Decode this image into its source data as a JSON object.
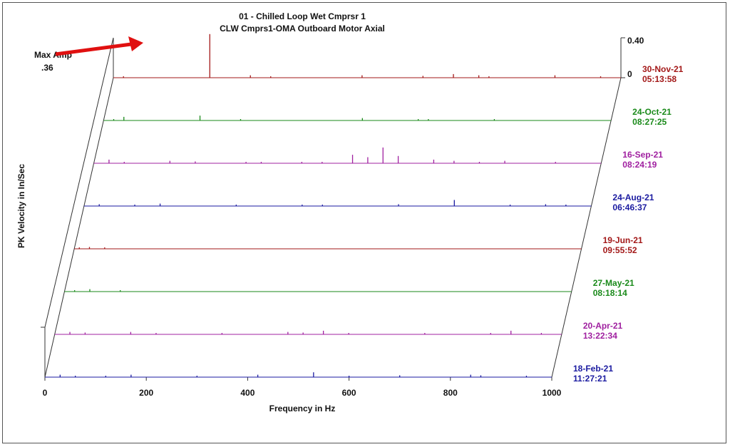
{
  "chart_data": {
    "type": "line",
    "subtype": "waterfall-spectrum",
    "title": "01   - Chilled Loop Wet Cmprsr 1",
    "subtitle": "CLW Cmprs1-OMA   Outboard Motor Axial",
    "xlabel": "Frequency in Hz",
    "ylabel": "PK Velocity in In/Sec",
    "xlim": [
      0,
      1000
    ],
    "x_ticks": [
      "0",
      "200",
      "400",
      "600",
      "800",
      "1000"
    ],
    "amp_scale": [
      0,
      0.4
    ],
    "amp_tick_labels": [
      "0.40",
      "0"
    ],
    "annotation": {
      "label": "Max Amp",
      "value": ".36"
    },
    "series": [
      {
        "date": "30-Nov-21",
        "time": "05:13:58",
        "color": "#a31818",
        "peaks": [
          [
            20,
            0.01
          ],
          [
            190,
            0.36
          ],
          [
            270,
            0.02
          ],
          [
            310,
            0.01
          ],
          [
            490,
            0.02
          ],
          [
            610,
            0.015
          ],
          [
            670,
            0.03
          ],
          [
            720,
            0.02
          ],
          [
            740,
            0.01
          ],
          [
            870,
            0.02
          ],
          [
            960,
            0.01
          ]
        ]
      },
      {
        "date": "24-Oct-21",
        "time": "08:27:25",
        "color": "#1a8a1a",
        "peaks": [
          [
            20,
            0.01
          ],
          [
            40,
            0.03
          ],
          [
            190,
            0.04
          ],
          [
            270,
            0.01
          ],
          [
            510,
            0.02
          ],
          [
            620,
            0.01
          ],
          [
            640,
            0.01
          ],
          [
            770,
            0.01
          ]
        ]
      },
      {
        "date": "16-Sep-21",
        "time": "08:24:19",
        "color": "#a020a0",
        "peaks": [
          [
            30,
            0.03
          ],
          [
            60,
            0.01
          ],
          [
            150,
            0.02
          ],
          [
            200,
            0.015
          ],
          [
            300,
            0.01
          ],
          [
            330,
            0.01
          ],
          [
            410,
            0.01
          ],
          [
            450,
            0.01
          ],
          [
            510,
            0.07
          ],
          [
            540,
            0.05
          ],
          [
            570,
            0.13
          ],
          [
            600,
            0.06
          ],
          [
            670,
            0.03
          ],
          [
            710,
            0.02
          ],
          [
            760,
            0.01
          ],
          [
            810,
            0.02
          ],
          [
            910,
            0.01
          ]
        ]
      },
      {
        "date": "24-Aug-21",
        "time": "06:46:37",
        "color": "#1a1aa0",
        "peaks": [
          [
            30,
            0.015
          ],
          [
            100,
            0.01
          ],
          [
            150,
            0.02
          ],
          [
            300,
            0.01
          ],
          [
            430,
            0.01
          ],
          [
            470,
            0.01
          ],
          [
            620,
            0.015
          ],
          [
            730,
            0.05
          ],
          [
            840,
            0.01
          ],
          [
            910,
            0.015
          ],
          [
            950,
            0.01
          ]
        ]
      },
      {
        "date": "19-Jun-21",
        "time": "09:55:52",
        "color": "#a31818",
        "peaks": [
          [
            10,
            0.005
          ],
          [
            30,
            0.015
          ],
          [
            60,
            0.005
          ]
        ]
      },
      {
        "date": "27-May-21",
        "time": "08:18:14",
        "color": "#1a8a1a",
        "peaks": [
          [
            20,
            0.01
          ],
          [
            50,
            0.02
          ],
          [
            110,
            0.005
          ]
        ]
      },
      {
        "date": "20-Apr-21",
        "time": "13:22:34",
        "color": "#a020a0",
        "peaks": [
          [
            30,
            0.02
          ],
          [
            60,
            0.015
          ],
          [
            150,
            0.02
          ],
          [
            200,
            0.01
          ],
          [
            330,
            0.01
          ],
          [
            460,
            0.02
          ],
          [
            490,
            0.015
          ],
          [
            530,
            0.03
          ],
          [
            580,
            0.01
          ],
          [
            730,
            0.01
          ],
          [
            860,
            0.01
          ],
          [
            900,
            0.03
          ],
          [
            960,
            0.01
          ]
        ]
      },
      {
        "date": "18-Feb-21",
        "time": "11:27:21",
        "color": "#1a1aa0",
        "peaks": [
          [
            30,
            0.02
          ],
          [
            60,
            0.01
          ],
          [
            120,
            0.01
          ],
          [
            170,
            0.02
          ],
          [
            300,
            0.01
          ],
          [
            420,
            0.02
          ],
          [
            530,
            0.04
          ],
          [
            600,
            0.01
          ],
          [
            700,
            0.015
          ],
          [
            840,
            0.02
          ],
          [
            860,
            0.015
          ],
          [
            950,
            0.01
          ]
        ]
      }
    ]
  }
}
